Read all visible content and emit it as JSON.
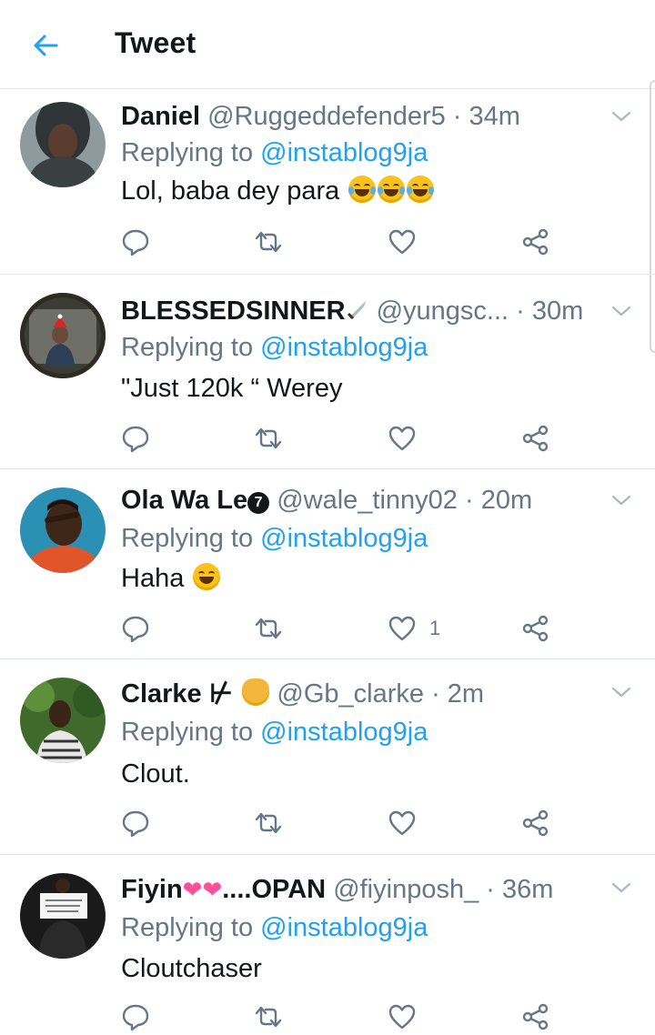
{
  "header": {
    "title": "Tweet",
    "back_icon": "arrow-left-icon",
    "accent": "#1da1f2"
  },
  "tweets": [
    {
      "name": "Daniel",
      "handle": "@Ruggeddefender5",
      "separator": "·",
      "time": "34m",
      "replying_prefix": "Replying to",
      "replying_to": "@instablog9ja",
      "text": "Lol, baba dey para",
      "text_emoji": "😂😂😂",
      "like_count": ""
    },
    {
      "name": "BLESSEDSINNER",
      "name_emoji": "🗡",
      "handle": "@yungsc...",
      "separator": "·",
      "time": "30m",
      "replying_prefix": "Replying to",
      "replying_to": "@instablog9ja",
      "text": "\"Just 120k “ Werey",
      "like_count": ""
    },
    {
      "name": "Ola Wa Le",
      "name_badge": "7",
      "handle": "@wale_tinny02",
      "separator": "·",
      "time": "20m",
      "replying_prefix": "Replying to",
      "replying_to": "@instablog9ja",
      "text": "Haha",
      "text_emoji": "😆",
      "like_count": "1"
    },
    {
      "name": "Clarke",
      "name_symbol": "⊬",
      "name_emoji": "😺",
      "handle": "@Gb_clarke",
      "separator": "·",
      "time": "2m",
      "replying_prefix": "Replying to",
      "replying_to": "@instablog9ja",
      "text": "Clout.",
      "like_count": ""
    },
    {
      "name": "Fiyin",
      "name_emoji": "💞",
      "name_suffix": "....OPAN",
      "handle": "@fiyinposh_",
      "separator": "·",
      "time": "36m",
      "replying_prefix": "Replying to",
      "replying_to": "@instablog9ja",
      "text": "Cloutchaser",
      "like_count": ""
    }
  ],
  "action_icons": [
    "reply-icon",
    "retweet-icon",
    "like-icon",
    "share-icon"
  ],
  "colors": {
    "text": "#14171a",
    "secondary": "#657786",
    "link": "#1da1f2",
    "divider": "#e1e8ed"
  }
}
